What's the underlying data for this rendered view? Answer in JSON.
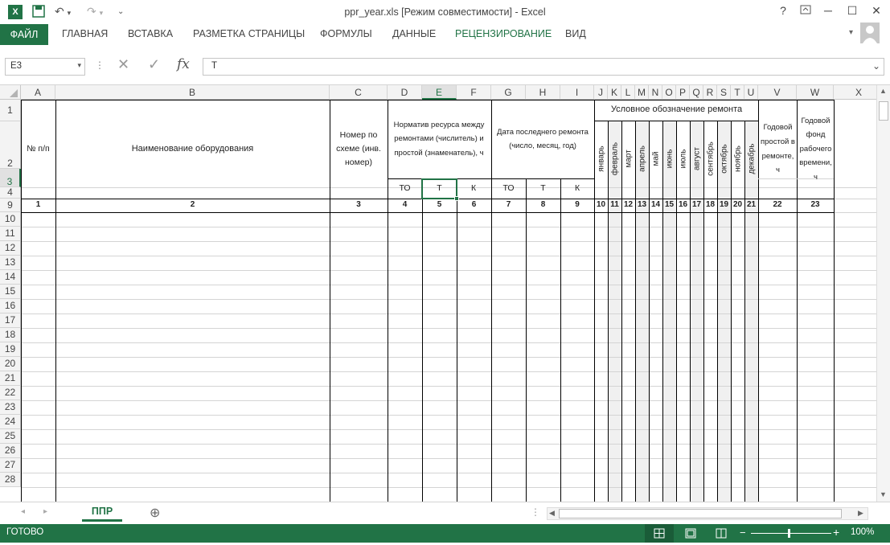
{
  "titlebar": {
    "title": "ppr_year.xls  [Режим совместимости] - Excel",
    "help": "?",
    "minimize": "─",
    "maximize": "☐",
    "close": "✕"
  },
  "ribbon": {
    "file_tab": "ФАЙЛ",
    "tabs": [
      "ГЛАВНАЯ",
      "ВСТАВКА",
      "РАЗМЕТКА СТРАНИЦЫ",
      "ФОРМУЛЫ",
      "ДАННЫЕ",
      "РЕЦЕНЗИРОВАНИЕ",
      "ВИД"
    ]
  },
  "formula_bar": {
    "name_box": "E3",
    "fx": "fx",
    "value": "Т"
  },
  "columns": [
    "A",
    "B",
    "C",
    "D",
    "E",
    "F",
    "G",
    "H",
    "I",
    "J",
    "K",
    "L",
    "M",
    "N",
    "O",
    "P",
    "Q",
    "R",
    "S",
    "T",
    "U",
    "V",
    "W",
    "X"
  ],
  "rows": [
    "1",
    "2",
    "3",
    "4",
    "9",
    "10",
    "11",
    "12",
    "13",
    "14",
    "15",
    "16",
    "17",
    "18",
    "19",
    "20",
    "21",
    "22",
    "23",
    "24",
    "25",
    "26",
    "27",
    "28"
  ],
  "header": {
    "col_a": "№ п/п",
    "col_b": "Наименование оборудования",
    "col_c": "Номер по схеме (инв. номер)",
    "col_def": "Норматив ресурса между ремонтами (числитель) и простой (знаменатель), ч",
    "col_ghi": "Дата последнего ремонта (число, месяц, год)",
    "col_jt": "Условное обозначение ремонта",
    "col_v": "Годовой простой в ремонте, ч",
    "col_w": "Годовой фонд рабочего времени, ч",
    "to_d": "ТО",
    "t_e": "Т",
    "k_f": "К",
    "to_g": "ТО",
    "t_h": "Т",
    "k_i": "К",
    "months": [
      "январь",
      "февраль",
      "март",
      "апрель",
      "май",
      "июнь",
      "июль",
      "август",
      "сентябрь",
      "октябрь",
      "ноябрь",
      "декабрь"
    ],
    "numbers": [
      "1",
      "2",
      "3",
      "4",
      "5",
      "6",
      "7",
      "8",
      "9",
      "10",
      "11",
      "12",
      "13",
      "14",
      "15",
      "16",
      "17",
      "18",
      "19",
      "20",
      "21",
      "22",
      "23"
    ]
  },
  "sheet": {
    "tab": "ППР",
    "add": "⊕"
  },
  "status": {
    "ready": "ГОТОВО",
    "zoom": "100%"
  },
  "colors": {
    "accent": "#217346"
  }
}
